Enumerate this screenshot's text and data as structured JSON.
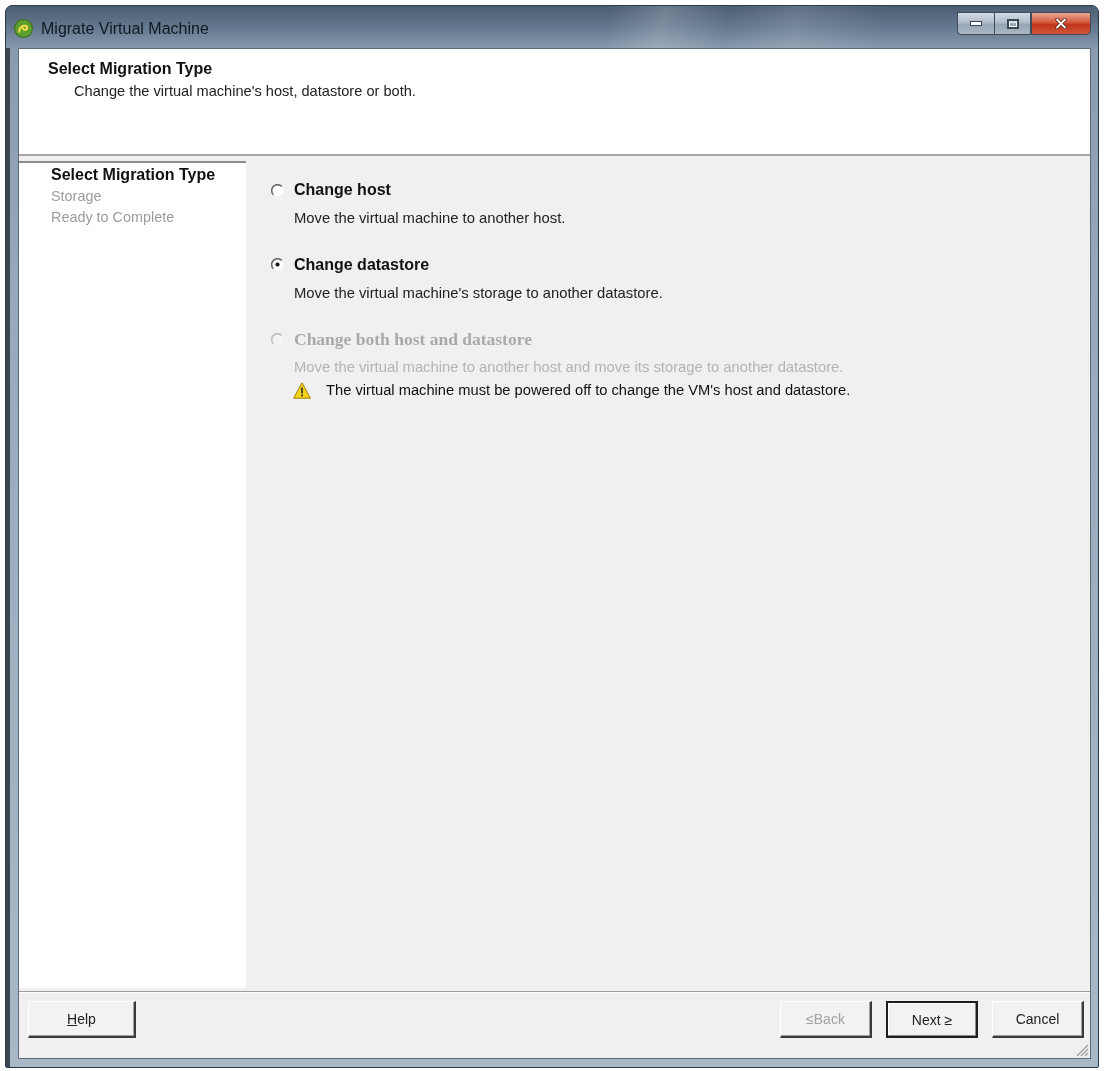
{
  "window": {
    "title": "Migrate Virtual Machine"
  },
  "header": {
    "title": "Select Migration Type",
    "subtitle": "Change the virtual machine's host, datastore or both."
  },
  "steps": [
    {
      "label": "Select Migration Type",
      "selected": true
    },
    {
      "label": "Storage",
      "selected": false
    },
    {
      "label": "Ready to Complete",
      "selected": false
    }
  ],
  "options": [
    {
      "label": "Change host",
      "description": "Move the virtual machine to another host.",
      "selected": false,
      "disabled": false
    },
    {
      "label": "Change datastore",
      "description": "Move the virtual machine's storage to another datastore.",
      "selected": true,
      "disabled": false
    },
    {
      "label": "Change both host and datastore",
      "description": "Move the virtual machine to another host and move its storage to another datastore.",
      "selected": false,
      "disabled": true,
      "warning": "The virtual machine must be powered off to change the VM's host and datastore."
    }
  ],
  "footer": {
    "help_button": {
      "label": "Help",
      "underline_first": true
    },
    "buttons": [
      {
        "label": "≤Back",
        "disabled": true,
        "default": false
      },
      {
        "label": "Next ≥",
        "disabled": false,
        "default": true
      },
      {
        "label": "Cancel",
        "disabled": false,
        "default": false
      }
    ]
  }
}
